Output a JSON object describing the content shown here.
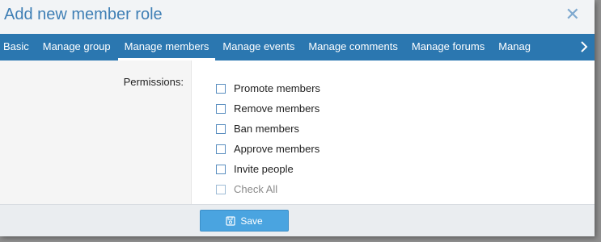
{
  "dialog": {
    "title": "Add new member role",
    "close_icon": "close-icon"
  },
  "tabs": [
    {
      "label": "Basic",
      "active": false
    },
    {
      "label": "Manage group",
      "active": false
    },
    {
      "label": "Manage members",
      "active": true
    },
    {
      "label": "Manage events",
      "active": false
    },
    {
      "label": "Manage comments",
      "active": false
    },
    {
      "label": "Manage forums",
      "active": false
    },
    {
      "label": "Manag",
      "active": false
    }
  ],
  "tab_next_icon": "chevron-right-icon",
  "form": {
    "permissions_label": "Permissions:",
    "options": [
      {
        "label": "Promote members",
        "checked": false
      },
      {
        "label": "Remove members",
        "checked": false
      },
      {
        "label": "Ban members",
        "checked": false
      },
      {
        "label": "Approve members",
        "checked": false
      },
      {
        "label": "Invite people",
        "checked": false
      },
      {
        "label": "Check All",
        "checked": false
      }
    ]
  },
  "footer": {
    "save_label": "Save",
    "save_icon": "save-icon"
  },
  "colors": {
    "accent": "#2b77b0",
    "title": "#3f7fb5",
    "button": "#4aa4e0"
  }
}
